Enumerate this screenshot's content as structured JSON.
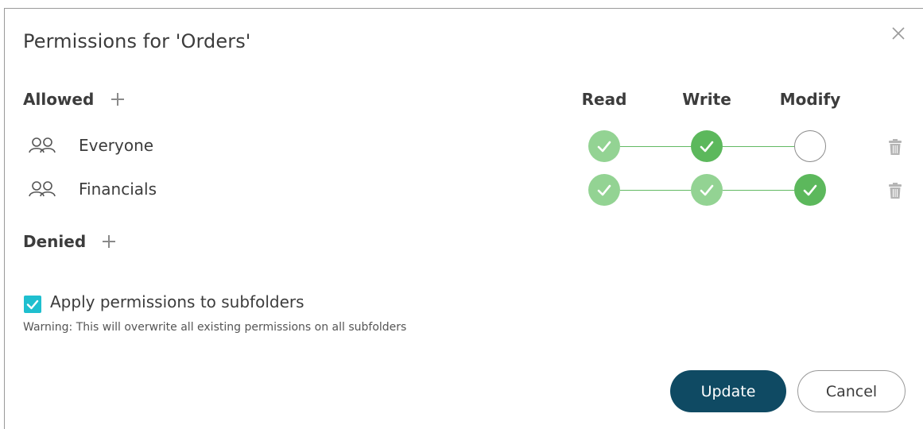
{
  "dialog": {
    "title": "Permissions for 'Orders'",
    "close_icon": "close-icon"
  },
  "allowed": {
    "label": "Allowed",
    "add_icon": "plus-icon"
  },
  "columns": [
    "Read",
    "Write",
    "Modify"
  ],
  "rows": [
    {
      "icon": "user-group-icon",
      "name": "Everyone",
      "read": "inherited",
      "write": "granted",
      "modify": "not-granted",
      "delete_icon": "trash-icon"
    },
    {
      "icon": "user-group-icon",
      "name": "Financials",
      "read": "inherited",
      "write": "inherited",
      "modify": "granted",
      "delete_icon": "trash-icon"
    }
  ],
  "denied": {
    "label": "Denied",
    "add_icon": "plus-icon"
  },
  "subfolders": {
    "checked": true,
    "label": "Apply permissions to subfolders",
    "warning": "Warning: This will overwrite all existing permissions on all subfolders"
  },
  "buttons": {
    "update": "Update",
    "cancel": "Cancel"
  },
  "colors": {
    "granted": "#5cb85c",
    "inherited": "#93d393",
    "primary_button": "#0f4a63",
    "checkbox": "#1fbfcf"
  }
}
